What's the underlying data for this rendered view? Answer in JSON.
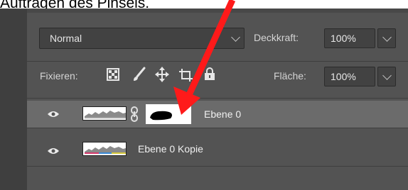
{
  "caption": "Auftragen des Pinsels.",
  "blend_mode": {
    "value": "Normal"
  },
  "opacity": {
    "label": "Deckkraft:",
    "value": "100%"
  },
  "lock": {
    "label": "Fixieren:"
  },
  "fill": {
    "label": "Fläche:",
    "value": "100%"
  },
  "layers": [
    {
      "name": "Ebene 0",
      "selected": true,
      "visible": true,
      "has_mask": true
    },
    {
      "name": "Ebene 0 Kopie",
      "selected": false,
      "visible": true,
      "has_mask": false
    }
  ],
  "colors": {
    "panel": "#535353",
    "selected_row": "#6b6b6b",
    "arrow": "#ff1a1a"
  },
  "icons": [
    "eye-icon",
    "chain-link-icon",
    "lock-transparent-icon",
    "lock-brush-icon",
    "lock-move-icon",
    "lock-artboard-icon",
    "lock-all-icon",
    "chevron-down-icon"
  ]
}
